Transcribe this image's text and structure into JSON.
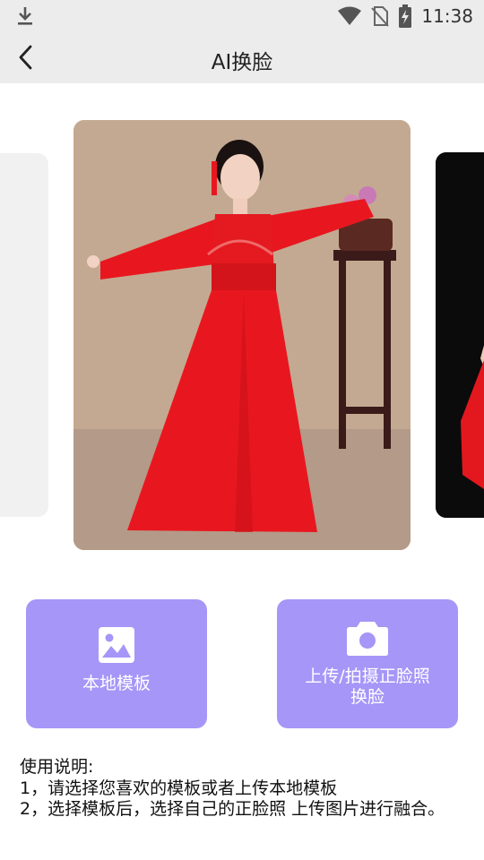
{
  "status_bar": {
    "time": "11:38",
    "icons": [
      "download-icon",
      "wifi-icon",
      "no-sim-icon",
      "battery-charging-icon"
    ]
  },
  "app_bar": {
    "back_icon": "chevron-left-icon",
    "title": "AI换脸"
  },
  "carousel": {
    "items": [
      "template-girl-red-hanfu",
      "template-red-dress-dark-bg"
    ]
  },
  "actions": {
    "local_template": {
      "label": "本地模板",
      "icon": "image-icon"
    },
    "upload_photo": {
      "label_line1": "上传/拍摄正脸照",
      "label_line2": "换脸",
      "icon": "camera-icon"
    }
  },
  "instructions": {
    "heading": "使用说明:",
    "line1": "1，请选择您喜欢的模板或者上传本地模板",
    "line2": "2，选择模板后，选择自己的正脸照 上传图片进行融合。"
  },
  "colors": {
    "bar_bg": "#ececec",
    "accent": "#a596f7",
    "dress_red": "#e8171f"
  }
}
